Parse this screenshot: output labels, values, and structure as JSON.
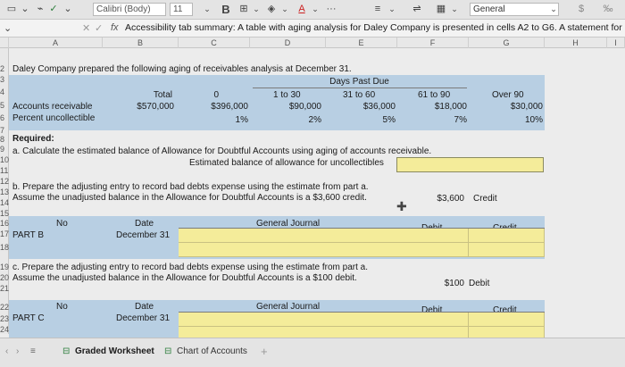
{
  "ribbon": {
    "font": "Calibri (Body)",
    "size": "11",
    "bold": "B",
    "number_format": "General",
    "ellipsis": "···",
    "dollar": "$"
  },
  "formula_bar": {
    "fx": "fx",
    "content": "Accessibility tab summary: A table with aging analysis for Daley Company is presented in cells A2 to G6. A statement for"
  },
  "columns": [
    "A",
    "B",
    "C",
    "D",
    "E",
    "F",
    "G",
    "H",
    "I"
  ],
  "rows": [
    "2",
    "3",
    "4",
    "5",
    "6",
    "7",
    "8",
    "9",
    "10",
    "11",
    "12",
    "13",
    "14",
    "15",
    "16",
    "17",
    "18",
    "19",
    "20",
    "21",
    "22",
    "23",
    "24"
  ],
  "sheet": {
    "title": "Daley Company prepared the following aging of receivables analysis at December 31.",
    "days_past_due": "Days Past Due",
    "headers": [
      "Total",
      "0",
      "1 to 30",
      "31 to 60",
      "61 to 90",
      "Over 90"
    ],
    "ar_label": "Accounts receivable",
    "ar_values": [
      "$570,000",
      "$396,000",
      "$90,000",
      "$36,000",
      "$18,000",
      "$30,000"
    ],
    "pct_label": "Percent uncollectible",
    "pct_values": [
      "1%",
      "2%",
      "5%",
      "7%",
      "10%"
    ],
    "required": "Required:",
    "part_a": "a. Calculate the estimated balance of Allowance for Doubtful Accounts using aging of accounts receivable.",
    "part_a_label": "Estimated balance of allowance for uncollectibles",
    "part_b1": "b. Prepare the adjusting entry to record bad debts expense using the estimate from part a.",
    "part_b2": "Assume the unadjusted balance in the Allowance for Doubtful Accounts is a $3,600 credit.",
    "b_balance": "$3,600",
    "b_balance_type": "Credit",
    "part_c1": "c. Prepare the adjusting entry to record bad debts expense using the estimate from part a.",
    "part_c2": "Assume the unadjusted balance in the Allowance for Doubtful Accounts is a $100 debit.",
    "c_balance": "$100",
    "c_balance_type": "Debit",
    "journal": {
      "no": "No",
      "date": "Date",
      "gj": "General Journal",
      "debit": "Debit",
      "credit": "Credit",
      "part_b": "PART B",
      "part_c": "PART C",
      "dec31": "December 31"
    }
  },
  "tabs": [
    "Graded Worksheet",
    "Chart of Accounts"
  ],
  "add_tab": "+"
}
